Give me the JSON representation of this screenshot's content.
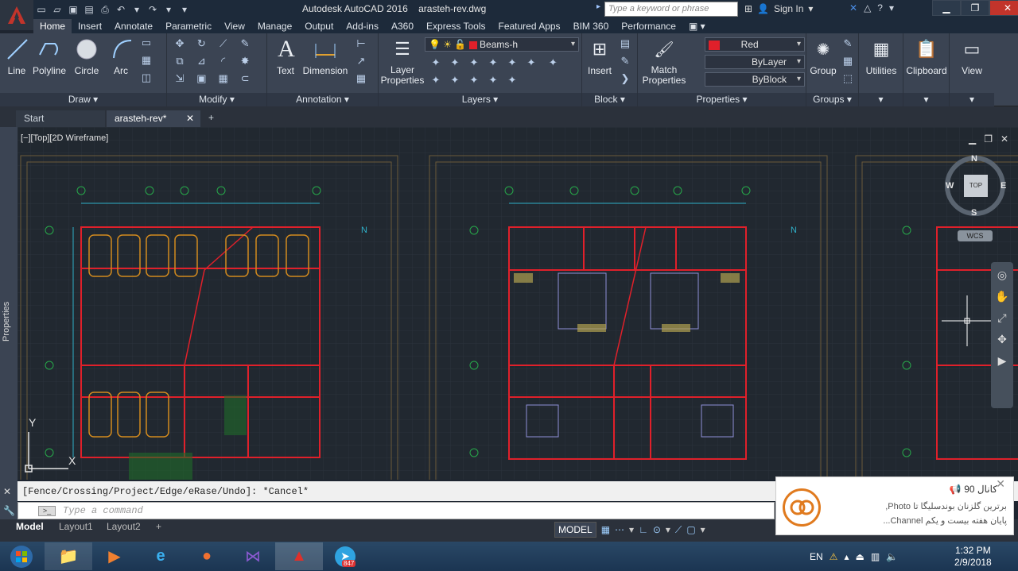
{
  "app": {
    "product": "Autodesk AutoCAD 2016",
    "file": "arasteh-rev.dwg",
    "search_placeholder": "Type a keyword or phrase",
    "sign_in": "Sign In"
  },
  "ribbon_tabs": [
    "Home",
    "Insert",
    "Annotate",
    "Parametric",
    "View",
    "Manage",
    "Output",
    "Add-ins",
    "A360",
    "Express Tools",
    "Featured Apps",
    "BIM 360",
    "Performance"
  ],
  "panels": {
    "draw": {
      "label": "Draw",
      "tools": [
        "Line",
        "Polyline",
        "Circle",
        "Arc"
      ]
    },
    "modify": {
      "label": "Modify"
    },
    "annotation": {
      "label": "Annotation",
      "tools": [
        "Text",
        "Dimension"
      ]
    },
    "layers": {
      "label": "Layers",
      "tool": "Layer Properties",
      "current_layer": "Beams-h"
    },
    "block": {
      "label": "Block",
      "tool": "Insert"
    },
    "properties": {
      "label": "Properties",
      "tool": "Match Properties",
      "color": "Red",
      "linetype": "ByLayer",
      "lineweight": "ByBlock"
    },
    "groups": {
      "label": "Groups",
      "tool": "Group"
    },
    "utilities": {
      "label": "Utilities"
    },
    "clipboard": {
      "label": "Clipboard"
    },
    "view": {
      "label": "View"
    }
  },
  "file_tabs": [
    "Start",
    "arasteh-rev*"
  ],
  "viewport": {
    "label": "[−][Top][2D Wireframe]",
    "viewcube": {
      "top": "TOP",
      "north": "N",
      "south": "S",
      "east": "E",
      "west": "W",
      "ucs": "WCS"
    },
    "ucs_y": "Y",
    "ucs_x": "X"
  },
  "properties_palette": "Properties",
  "command": {
    "history": "[Fence/Crossing/Project/Edge/eRase/Undo]: *Cancel*",
    "placeholder": "Type a command"
  },
  "layout_tabs": [
    "Model",
    "Layout1",
    "Layout2"
  ],
  "status": {
    "model": "MODEL"
  },
  "notification": {
    "title": "کانال 90",
    "line1": "برترین گلزنان بوندسلیگا تا Photo,",
    "line2": "پایان هفته بیست و یکم Channel..."
  },
  "tray": {
    "lang": "EN",
    "time": "1:32 PM",
    "date": "2/9/2018",
    "telegram_badge": "847"
  },
  "colors": {
    "accent": "#c2342b",
    "ribbon": "#3b4453",
    "drawing_red": "#e0202a",
    "drawing_orange": "#d28a1e",
    "drawing_cyan": "#2fb0c8",
    "drawing_green": "#27a84a"
  }
}
